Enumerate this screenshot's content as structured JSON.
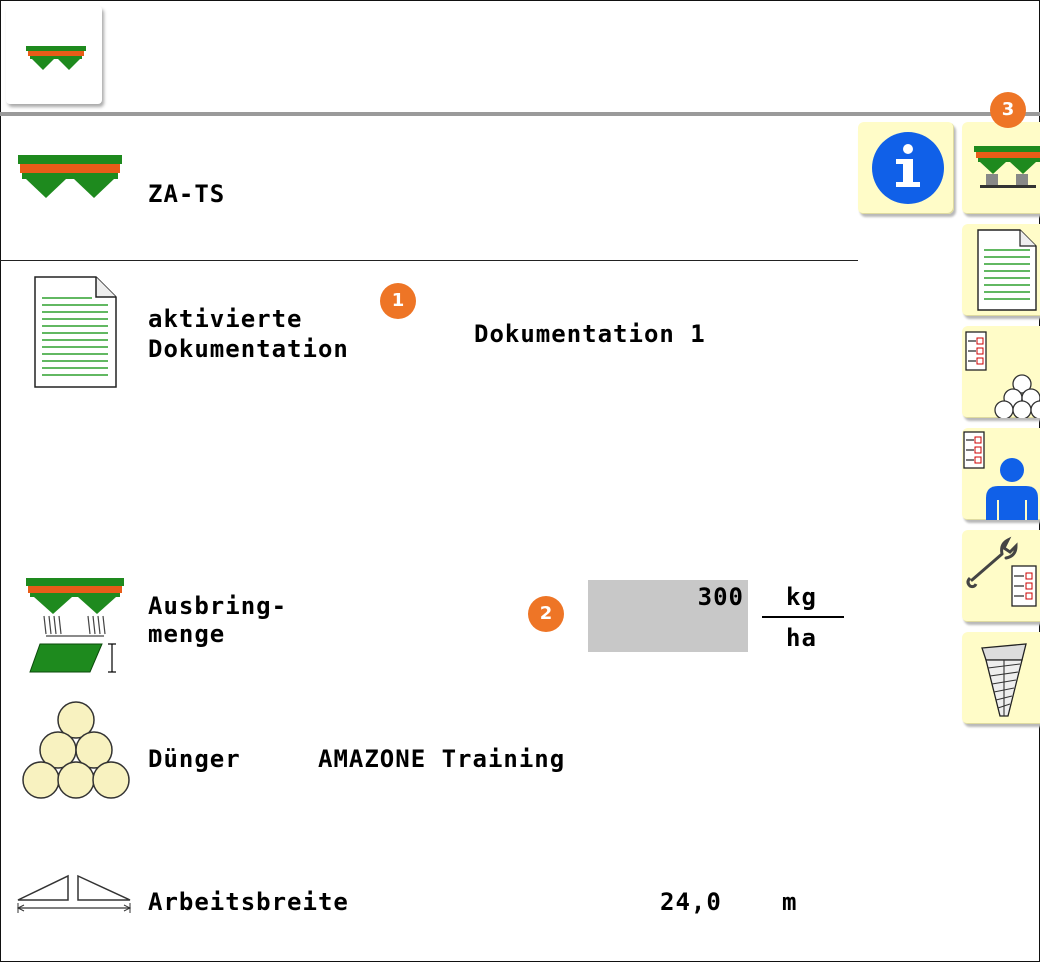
{
  "colors": {
    "accent": "#ee7526",
    "button_bg": "#fffcc8",
    "spreader_green": "#1e8a1e",
    "spreader_orange": "#e85c18",
    "info_blue": "#1060e8",
    "input_bg": "#c8c8c8"
  },
  "header": {
    "home_icon": "spreader-icon"
  },
  "machine": {
    "name": "ZA-TS",
    "icon": "spreader-icon"
  },
  "documentation": {
    "label_line1": "aktivierte",
    "label_line2": "Dokumentation",
    "value": "Dokumentation 1",
    "icon": "document-icon"
  },
  "rate": {
    "label_line1": "Ausbring-",
    "label_line2": "menge",
    "value": "300",
    "unit_top": "kg",
    "unit_bottom": "ha",
    "icon": "spreader-rate-icon"
  },
  "fertilizer": {
    "label": "Dünger",
    "value": "AMAZONE Training",
    "icon": "fertilizer-balls-icon"
  },
  "width": {
    "label": "Arbeitsbreite",
    "value": "24,0",
    "unit": "m",
    "icon": "working-width-icon"
  },
  "callouts": [
    "1",
    "2",
    "3"
  ],
  "side_buttons": [
    {
      "name": "info-button",
      "icon": "info-icon"
    },
    {
      "name": "machine-menu-button",
      "icon": "spreader-icon"
    },
    {
      "name": "documentation-button",
      "icon": "document-icon"
    },
    {
      "name": "fertilizer-menu-button",
      "icon": "fertilizer-list-icon"
    },
    {
      "name": "profile-menu-button",
      "icon": "profile-icon"
    },
    {
      "name": "setup-menu-button",
      "icon": "wrench-list-icon"
    },
    {
      "name": "hopper-button",
      "icon": "hopper-icon"
    }
  ]
}
